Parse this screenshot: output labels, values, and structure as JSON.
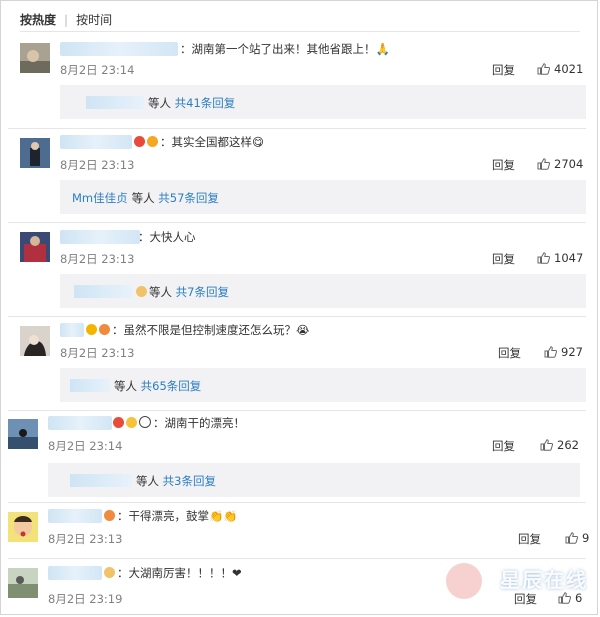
{
  "sort": {
    "hot": "按热度",
    "time": "按时间"
  },
  "comments": [
    {
      "text": "：湖南第一个站了出来！其他省跟上！🙏",
      "time": "8月2日 23:14",
      "reply": "回复",
      "likes": "4021",
      "sub": {
        "prefix": "",
        "mid": "等人",
        "link": "共41条回复"
      }
    },
    {
      "text": "：其实全国都这样😋",
      "time": "8月2日 23:13",
      "reply": "回复",
      "likes": "2704",
      "sub": {
        "prefix": "Mm佳佳贞",
        "mid": "等人",
        "link": "共57条回复"
      }
    },
    {
      "text": "：大快人心",
      "time": "8月2日 23:13",
      "reply": "回复",
      "likes": "1047",
      "sub": {
        "prefix": "",
        "mid": "等人",
        "link": "共7条回复"
      }
    },
    {
      "text": "：虽然不限是但控制速度还怎么玩？😭",
      "time": "8月2日 23:13",
      "reply": "回复",
      "likes": "927",
      "sub": {
        "prefix": "",
        "mid": "等人",
        "link": "共65条回复"
      }
    },
    {
      "text": "：湖南干的漂亮！",
      "time": "8月2日 23:14",
      "reply": "回复",
      "likes": "262",
      "sub": {
        "prefix": "",
        "mid": "等人",
        "link": "共3条回复"
      }
    },
    {
      "text": "：干得漂亮，鼓掌👏👏",
      "time": "8月2日 23:13",
      "reply": "回复",
      "likes": "9"
    },
    {
      "text": "：大湖南厉害！！！！❤",
      "time": "8月2日 23:19",
      "reply": "回复",
      "likes": "6"
    }
  ],
  "watermark": "星辰在线"
}
